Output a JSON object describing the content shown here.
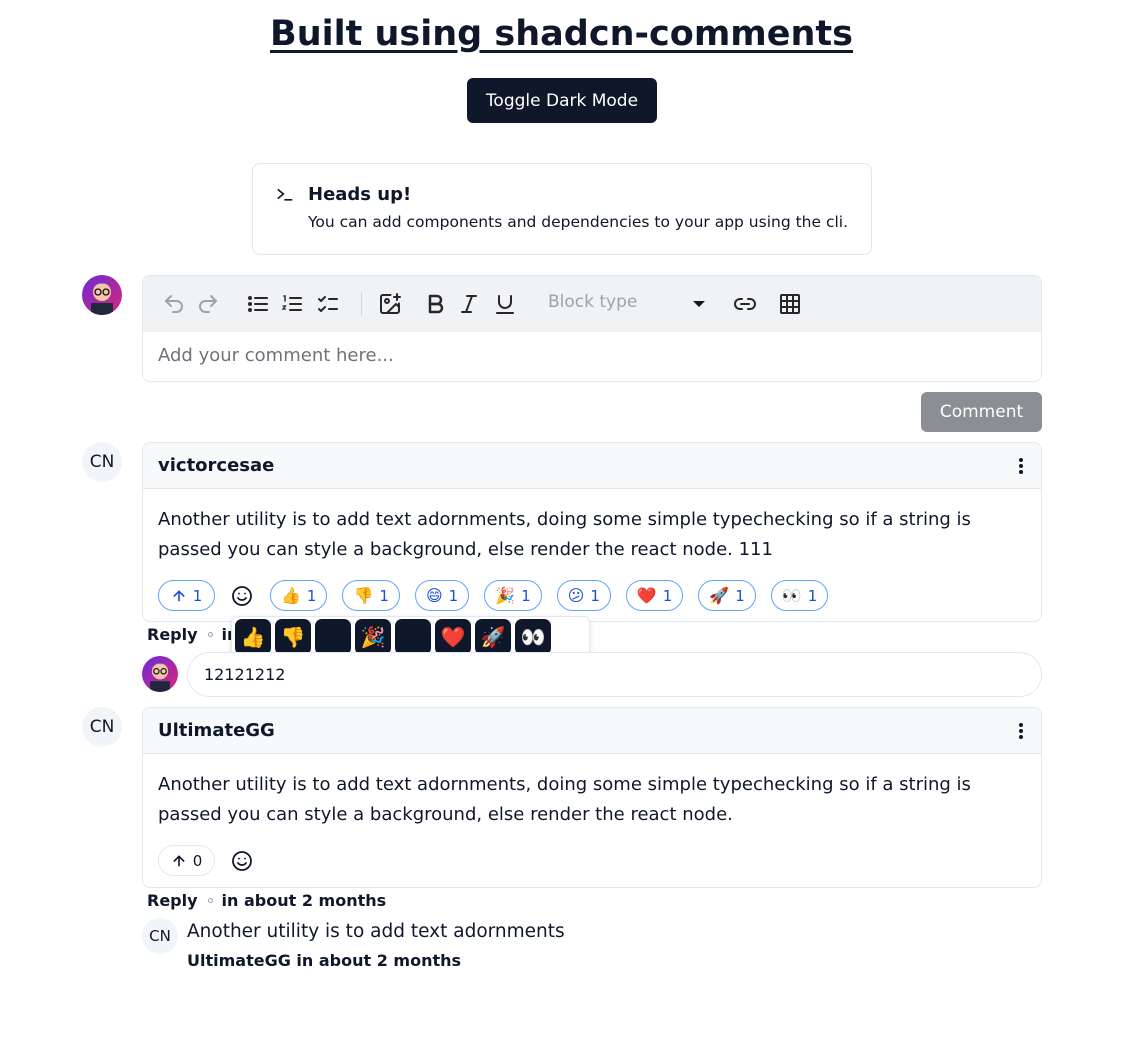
{
  "page": {
    "title": "Built using shadcn-comments",
    "toggle_label": "Toggle Dark Mode"
  },
  "alert": {
    "icon": "terminal-icon",
    "title": "Heads up!",
    "description": "You can add components and dependencies to your app using the cli."
  },
  "editor": {
    "block_type_placeholder": "Block type",
    "input_placeholder": "Add your comment here...",
    "submit_label": "Comment",
    "toolbar_icons": [
      "undo-icon",
      "redo-icon",
      "bullet-list-icon",
      "numbered-list-icon",
      "check-list-icon",
      "image-icon",
      "bold-icon",
      "italic-icon",
      "underline-icon",
      "link-icon",
      "table-icon"
    ]
  },
  "initials": "CN",
  "comments": [
    {
      "user": "victorcesae",
      "text": "Another utility is to add text adornments, doing some simple typechecking so if a string is passed you can style a background, else render the react node. 111",
      "upvotes": "1",
      "reactions": [
        {
          "emoji": "👍",
          "count": "1"
        },
        {
          "emoji": "👎",
          "count": "1"
        },
        {
          "emoji": "😄",
          "count": "1"
        },
        {
          "emoji": "🎉",
          "count": "1"
        },
        {
          "emoji": "😕",
          "count": "1"
        },
        {
          "emoji": "❤️",
          "count": "1"
        },
        {
          "emoji": "🚀",
          "count": "1"
        },
        {
          "emoji": "👀",
          "count": "1"
        }
      ],
      "reply_label": "Reply",
      "time": "in"
    },
    {
      "user": "UltimateGG",
      "text": "Another utility is to add text adornments, doing some simple typechecking so if a string is passed you can style a background, else render the react node.",
      "upvotes": "0",
      "reply_label": "Reply",
      "time": "in about 2 months",
      "replies": [
        {
          "text": "Another utility is to add text adornments",
          "user": "UltimateGG",
          "time": "in about 2 months"
        }
      ]
    }
  ],
  "emoji_picker": [
    "👍",
    "👎",
    "😄",
    "🎉",
    "😕",
    "❤️",
    "🚀",
    "👀"
  ],
  "reply_input_value": "12121212"
}
